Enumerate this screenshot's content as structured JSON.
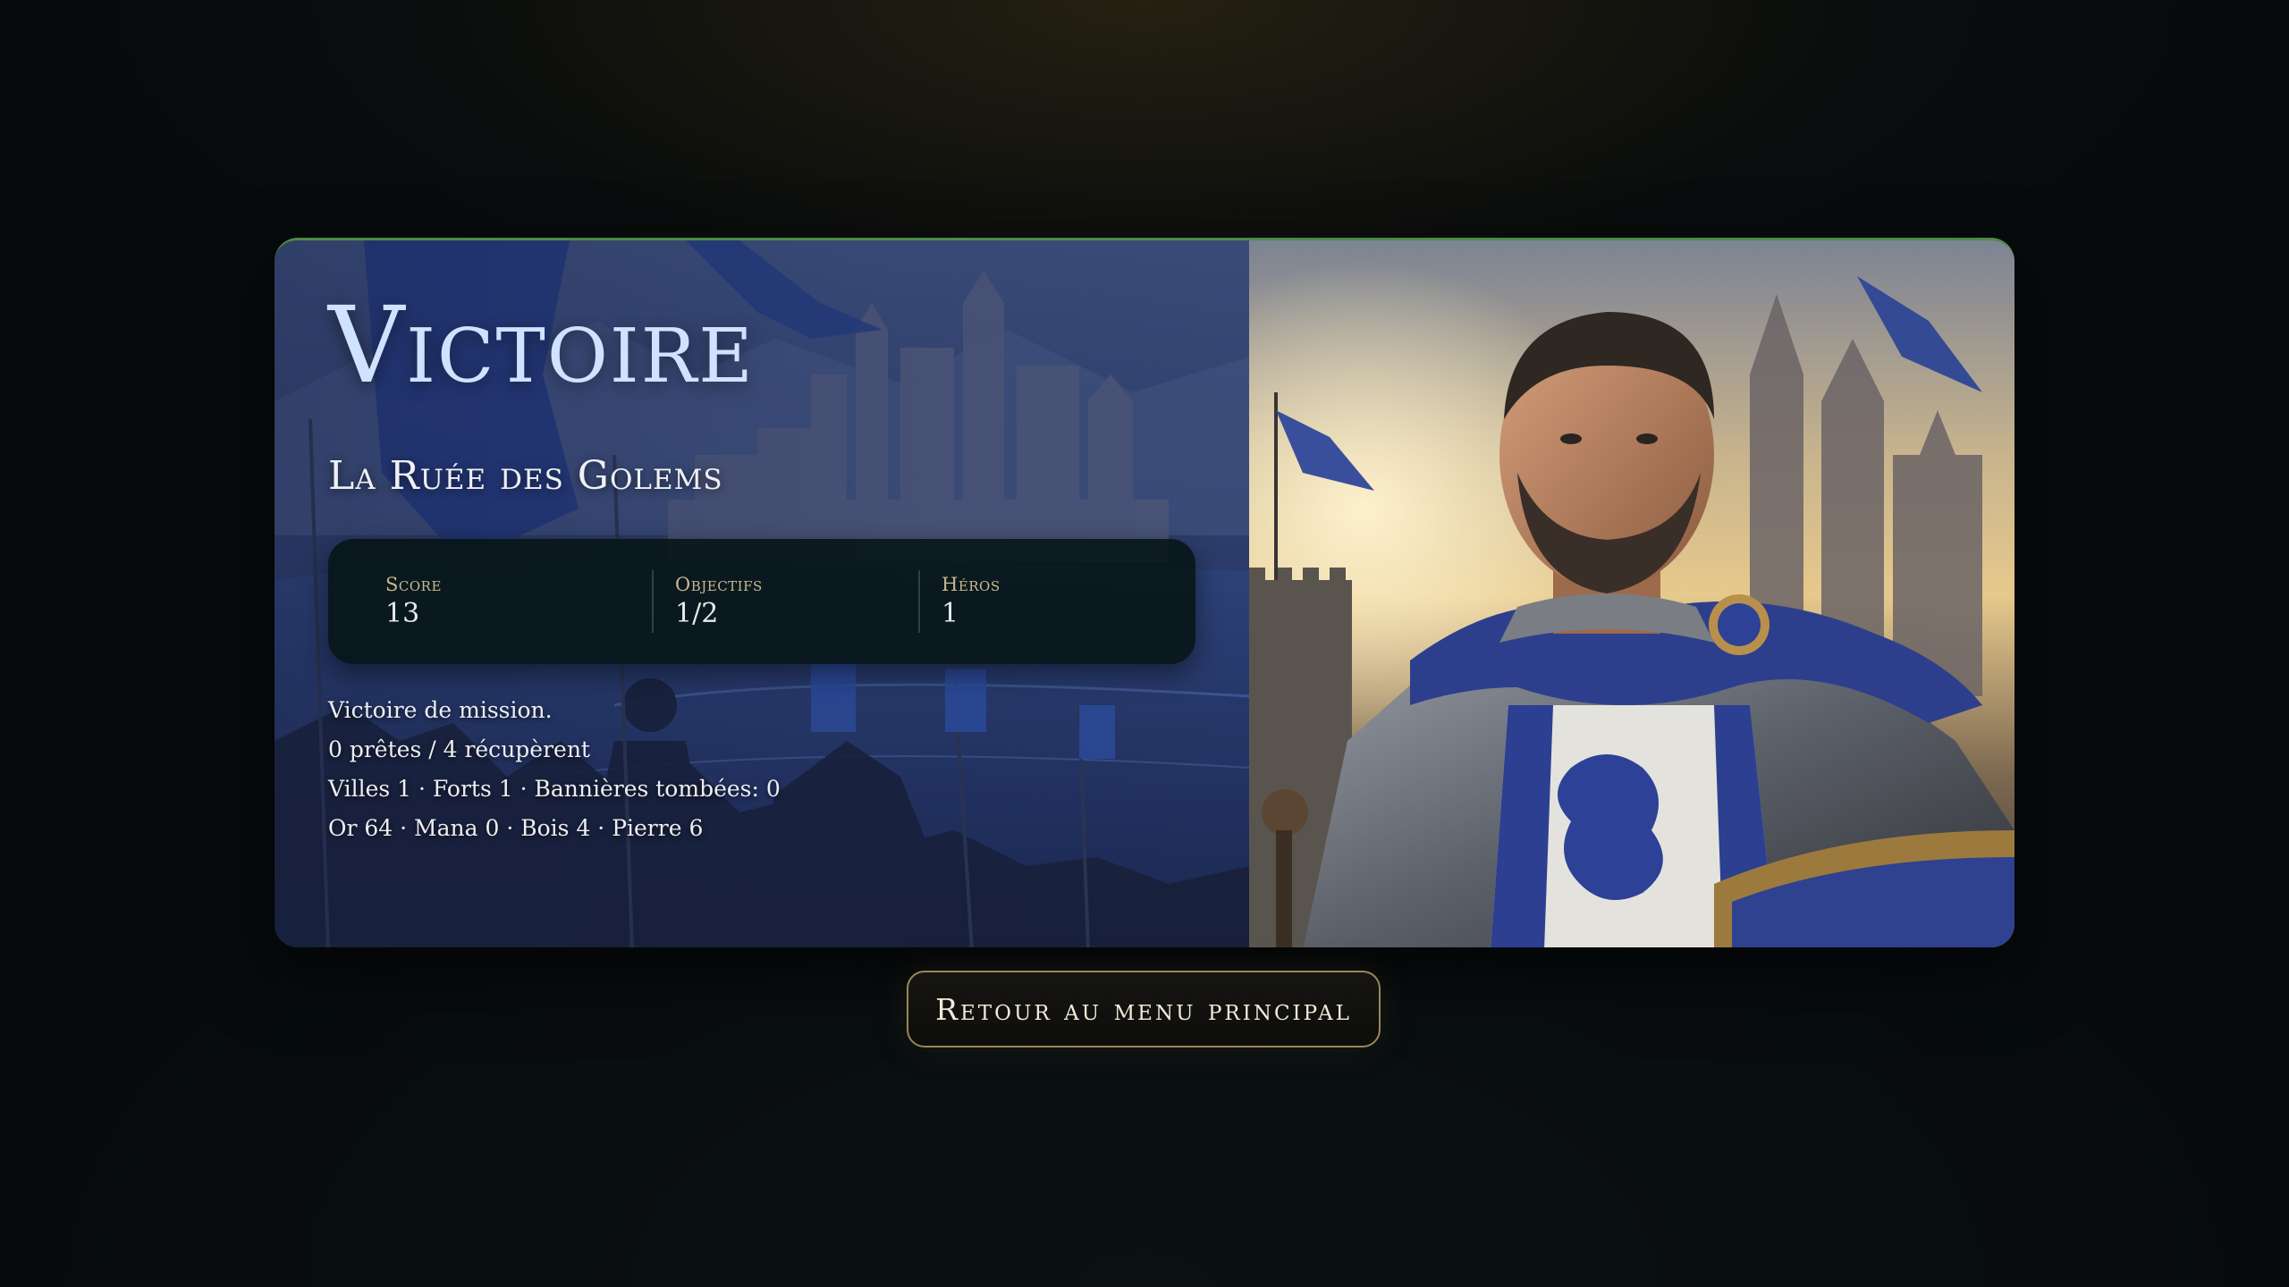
{
  "result": {
    "title": "Victoire",
    "mission_name": "La Ruée des Golems"
  },
  "stats": [
    {
      "label": "Score",
      "value": "13"
    },
    {
      "label": "Objectifs",
      "value": "1/2"
    },
    {
      "label": "Héros",
      "value": "1"
    }
  ],
  "details": [
    "Victoire de mission.",
    "0 prêtes / 4 récupèrent",
    "Villes 1 · Forts 1 · Bannières tombées: 0",
    "Or 64 · Mana 0 · Bois 4 · Pierre 6"
  ],
  "actions": {
    "return_label": "Retour au menu principal"
  },
  "colors": {
    "title": "#cfe2ff",
    "stat_label": "#c9b98c",
    "card_border_top": "#4f8a4a",
    "button_border": "#9c8558",
    "background": "#070b0d"
  }
}
